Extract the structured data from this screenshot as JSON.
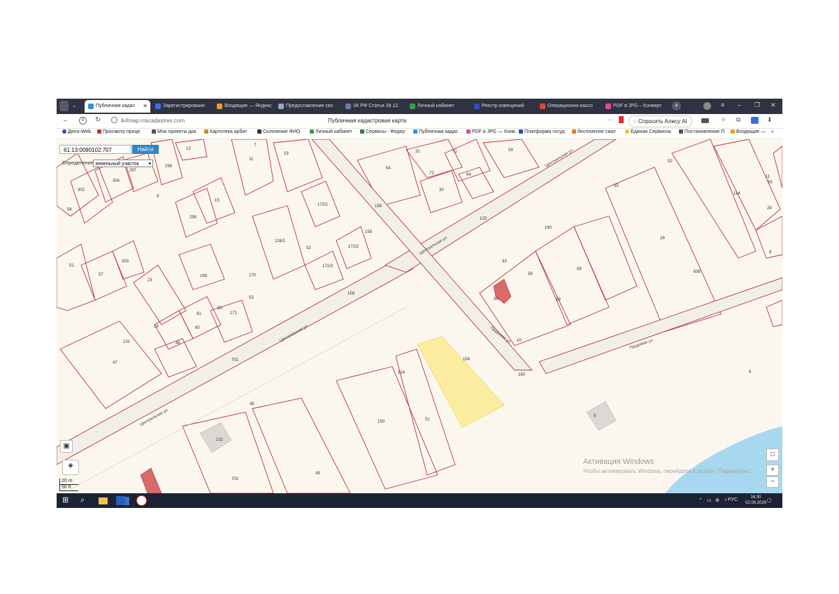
{
  "browser": {
    "tabs": [
      {
        "label": "Публичная кадас",
        "active": true,
        "color": "#3a8fd6"
      },
      {
        "label": "Зарегистрированн",
        "active": false,
        "color": "#3b6fe0"
      },
      {
        "label": "Входящие — Яндекс",
        "active": false,
        "color": "#f0a01e"
      },
      {
        "label": "Предоставление сво",
        "active": false,
        "color": "#9aa6c7"
      },
      {
        "label": "ЗК РФ Статья 39.12.",
        "active": false,
        "color": "#6b7aa8"
      },
      {
        "label": "Личный кабинет",
        "active": false,
        "color": "#3b9a4e"
      },
      {
        "label": "Реестр извещений",
        "active": false,
        "color": "#2e4fb5"
      },
      {
        "label": "Операционно-кассо",
        "active": false,
        "color": "#d64a3a"
      },
      {
        "label": "PDF в JPG – Конверт",
        "active": false,
        "color": "#e04b8f"
      }
    ],
    "url": "lk4map.roscadastres.com",
    "page_title": "Публичная кадастровая карта",
    "alice_label": "Спросить Алису AI",
    "bookmarks": [
      {
        "label": "Дело-Web",
        "color": "#2e4fb5"
      },
      {
        "label": "Просмотр проце",
        "color": "#c0392b"
      },
      {
        "label": "Мои проекты док",
        "color": "#555555"
      },
      {
        "label": "Картотека арбит",
        "color": "#d68a1e"
      },
      {
        "label": "Склонение ФИО",
        "color": "#333333"
      },
      {
        "label": "Личный кабинет",
        "color": "#3b9a4e"
      },
      {
        "label": "Сервисы - Федер",
        "color": "#2e7d32"
      },
      {
        "label": "Публичная кадас",
        "color": "#3a8fd6"
      },
      {
        "label": "PDF в JPG — Конв",
        "color": "#e04b8f"
      },
      {
        "label": "Платформа госуд",
        "color": "#2e4fb5"
      },
      {
        "label": "бесплатное сжат",
        "color": "#e67e22"
      },
      {
        "label": "Единая Сервисна",
        "color": "#f1c40f"
      },
      {
        "label": "Постановление П",
        "color": "#555555"
      },
      {
        "label": "Входящие —",
        "color": "#f0a01e"
      }
    ]
  },
  "map": {
    "search_value": "61:13:0090102:707",
    "search_button": "Найти",
    "definition_label": "Определение:",
    "definition_value": "земельный участок",
    "scale_m": "20 m",
    "scale_ft": "50 ft",
    "parcel_labels": [
      "298",
      "13",
      "7",
      "11",
      "19",
      "297",
      "302",
      "304",
      "8",
      "15",
      "299",
      "172/1",
      "126/1",
      "52",
      "172/2",
      "172/3",
      "303",
      "57",
      "51",
      "23",
      "169",
      "50",
      "171",
      "61",
      "60",
      "48",
      "131",
      "47",
      "45",
      "132",
      "702",
      "49",
      "124",
      "150",
      "51",
      "154",
      "54",
      "72",
      "30",
      "31",
      "71",
      "64",
      "59",
      "52",
      "114",
      "55",
      "11",
      "28",
      "29",
      "58",
      "58",
      "59",
      "10",
      "698",
      "9",
      "8",
      "5",
      "55",
      "160",
      "159",
      "158",
      "158",
      "701",
      "125",
      "170",
      "53",
      "33",
      "13",
      "56",
      "59",
      "160"
    ],
    "street_labels": [
      "Центральная ул.",
      "Центральная ул.",
      "Центральная ул.",
      "Прудовая ул.",
      "Прудовая ул.",
      "Центральная ул."
    ],
    "watermark_title": "Активация Windows",
    "watermark_text": "Чтобы активировать Windows, перейдите в раздел \"Параметры\"."
  },
  "taskbar": {
    "lang": "РУС",
    "time": "16:30",
    "date": "02.09.2026"
  },
  "colors": {
    "parcel_stroke": "#b8323c",
    "selected_fill": "#fbeda0",
    "road_fill": "#f2efe9",
    "road_stroke": "#b8323c",
    "water": "#a8d8f0",
    "building": "#dcd9d4"
  }
}
